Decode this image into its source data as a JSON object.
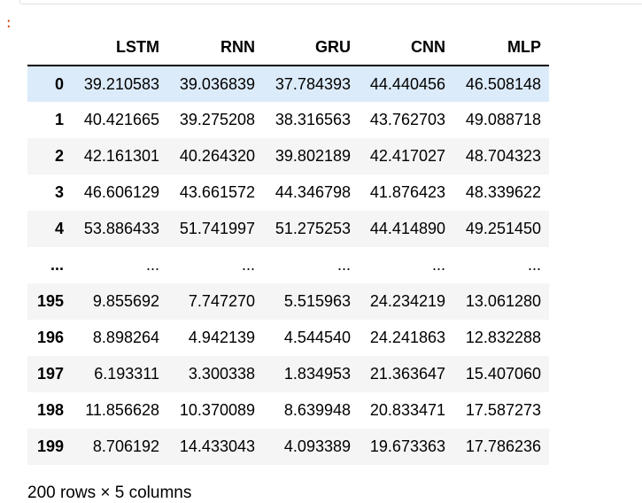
{
  "prompt_marker": ":",
  "table": {
    "columns": [
      "LSTM",
      "RNN",
      "GRU",
      "CNN",
      "MLP"
    ],
    "rows": [
      {
        "index": "0",
        "values": [
          "39.210583",
          "39.036839",
          "37.784393",
          "44.440456",
          "46.508148"
        ],
        "highlighted": true
      },
      {
        "index": "1",
        "values": [
          "40.421665",
          "39.275208",
          "38.316563",
          "43.762703",
          "49.088718"
        ]
      },
      {
        "index": "2",
        "values": [
          "42.161301",
          "40.264320",
          "39.802189",
          "42.417027",
          "48.704323"
        ]
      },
      {
        "index": "3",
        "values": [
          "46.606129",
          "43.661572",
          "44.346798",
          "41.876423",
          "48.339622"
        ]
      },
      {
        "index": "4",
        "values": [
          "53.886433",
          "51.741997",
          "51.275253",
          "44.414890",
          "49.251450"
        ]
      },
      {
        "index": "...",
        "values": [
          "...",
          "...",
          "...",
          "...",
          "..."
        ]
      },
      {
        "index": "195",
        "values": [
          "9.855692",
          "7.747270",
          "5.515963",
          "24.234219",
          "13.061280"
        ]
      },
      {
        "index": "196",
        "values": [
          "8.898264",
          "4.942139",
          "4.544540",
          "24.241863",
          "12.832288"
        ]
      },
      {
        "index": "197",
        "values": [
          "6.193311",
          "3.300338",
          "1.834953",
          "21.363647",
          "15.407060"
        ]
      },
      {
        "index": "198",
        "values": [
          "11.856628",
          "10.370089",
          "8.639948",
          "20.833471",
          "17.587273"
        ]
      },
      {
        "index": "199",
        "values": [
          "8.706192",
          "14.433043",
          "4.093389",
          "19.673363",
          "17.786236"
        ]
      }
    ]
  },
  "summary": "200 rows × 5 columns",
  "colors": {
    "highlight_row": "#dcebfa",
    "striped_row": "#f5f5f5",
    "prompt": "#d84315"
  }
}
